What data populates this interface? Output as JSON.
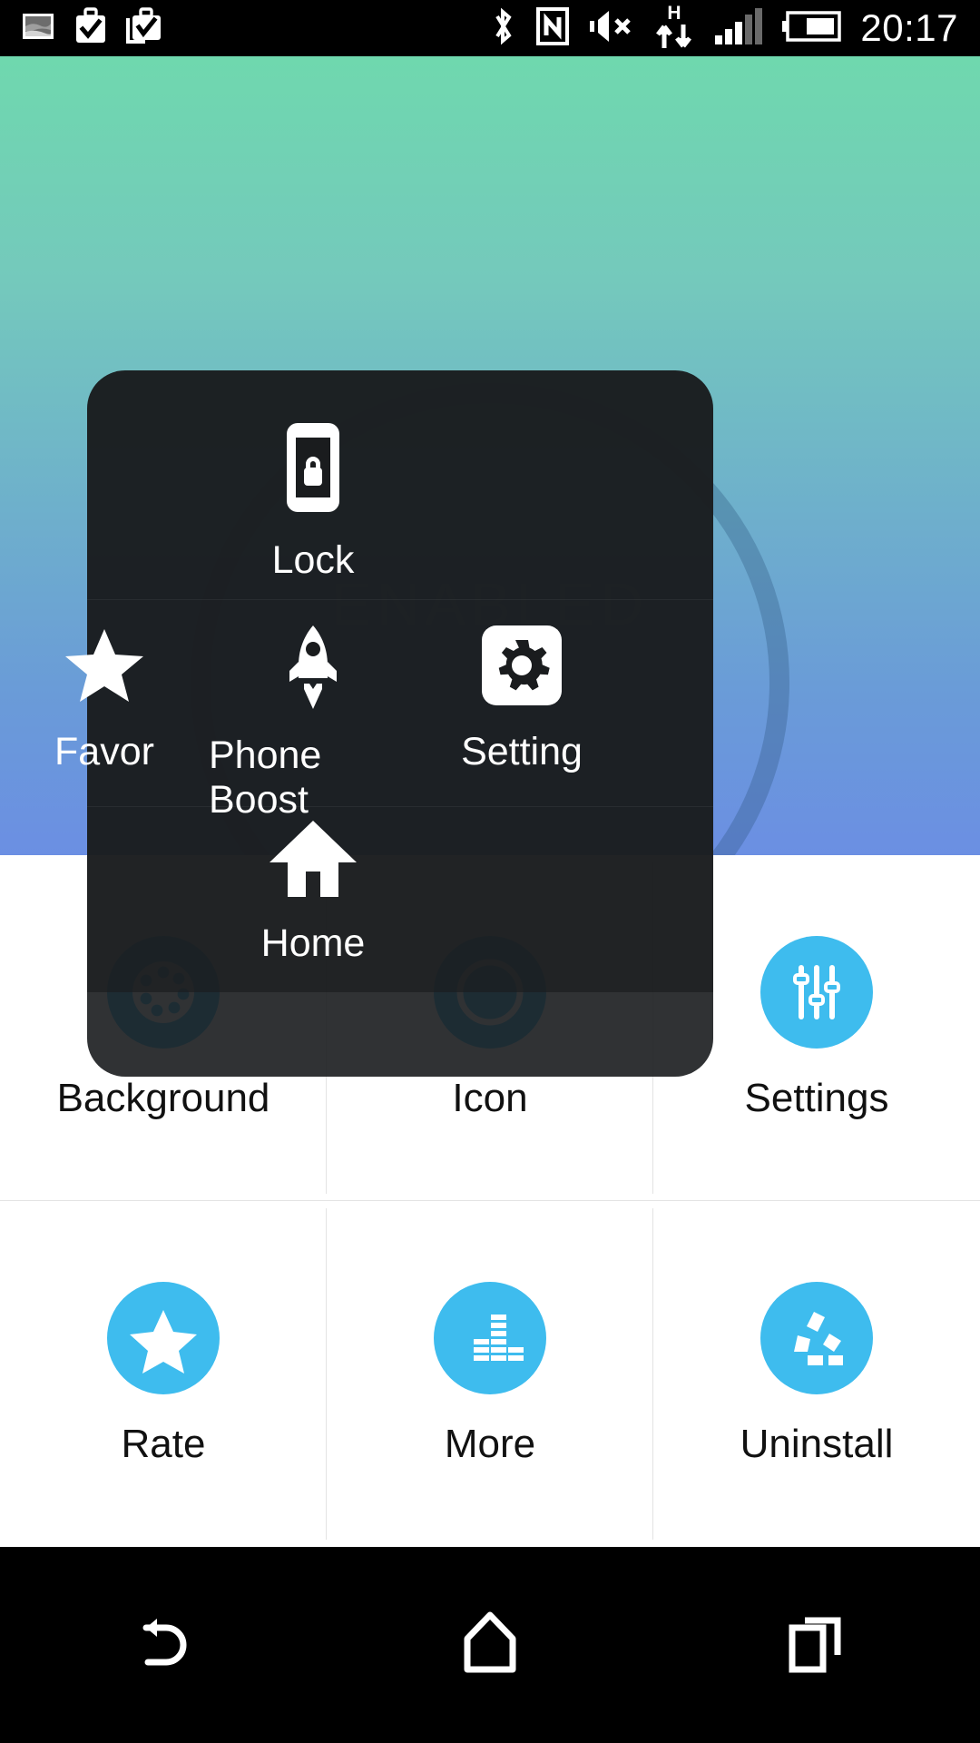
{
  "statusbar": {
    "time": "20:17",
    "left_icons": [
      "gallery-icon",
      "briefcase-check-icon",
      "briefcase-check-copy-icon"
    ],
    "right_icons": [
      "bluetooth-icon",
      "nfc-icon",
      "volume-mute-icon",
      "hspa-data-icon",
      "signal-bars-icon",
      "battery-icon"
    ],
    "signal_bars_active": 3,
    "signal_bars_total": 5,
    "battery_level_pct": 60
  },
  "wallpaper": {
    "status_text": "ENABLED",
    "gradient_top": "#6FD8AE",
    "gradient_bottom": "#6B8FE3",
    "ring_color": "#4A7896"
  },
  "panel": {
    "background": "#1A1C1E",
    "rows": [
      {
        "items": [
          {
            "label": "Lock",
            "icon": "phone-lock-icon"
          }
        ]
      },
      {
        "items": [
          {
            "label": "Favor",
            "icon": "star-icon"
          },
          {
            "label": "Phone Boost",
            "icon": "rocket-icon"
          },
          {
            "label": "Setting",
            "icon": "gear-icon"
          }
        ]
      },
      {
        "items": [
          {
            "label": "Home",
            "icon": "home-icon"
          }
        ]
      }
    ]
  },
  "grid": {
    "accent": "#3EBCEE",
    "items": [
      {
        "label": "Background",
        "icon": "palette-icon"
      },
      {
        "label": "Icon",
        "icon": "circle-icon"
      },
      {
        "label": "Settings",
        "icon": "sliders-icon"
      },
      {
        "label": "Rate",
        "icon": "star-circle-icon"
      },
      {
        "label": "More",
        "icon": "equalizer-icon"
      },
      {
        "label": "Uninstall",
        "icon": "recycle-icon"
      }
    ]
  },
  "navbar": {
    "buttons": [
      {
        "name": "back",
        "icon": "back-arrow-icon"
      },
      {
        "name": "home",
        "icon": "home-pentagon-icon"
      },
      {
        "name": "recents",
        "icon": "recents-icon"
      }
    ]
  }
}
